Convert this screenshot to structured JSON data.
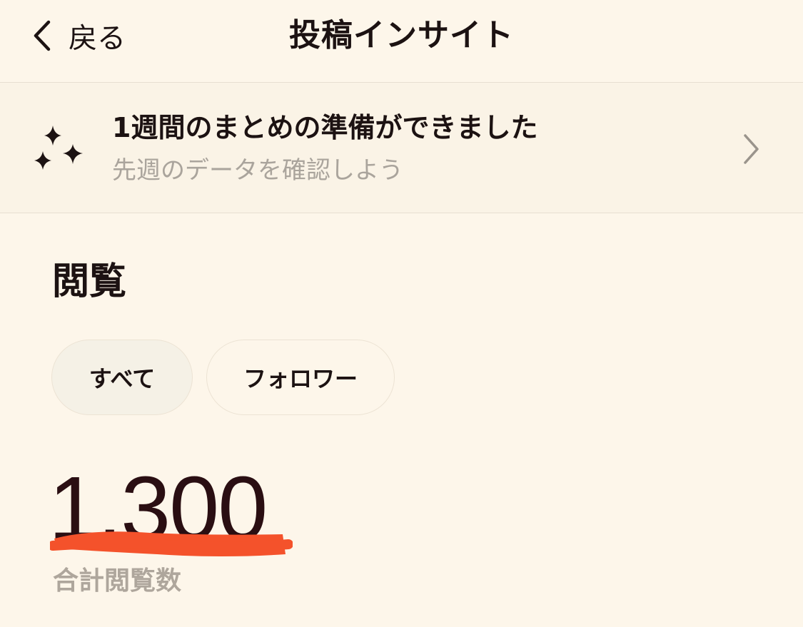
{
  "nav": {
    "back_label": "戻る",
    "title": "投稿インサイト"
  },
  "banner": {
    "title": "1週間のまとめの準備ができました",
    "subtitle": "先週のデータを確認しよう",
    "icon": "sparkles-icon"
  },
  "views": {
    "section_title": "閲覧",
    "filters": [
      {
        "label": "すべて",
        "selected": true
      },
      {
        "label": "フォロワー",
        "selected": false
      }
    ],
    "total_value": "1,300",
    "total_label": "合計閲覧数"
  },
  "colors": {
    "background": "#fdf6ea",
    "text": "#1c1212",
    "muted_text": "#aaa49c",
    "redaction_mark": "#f4522b"
  }
}
